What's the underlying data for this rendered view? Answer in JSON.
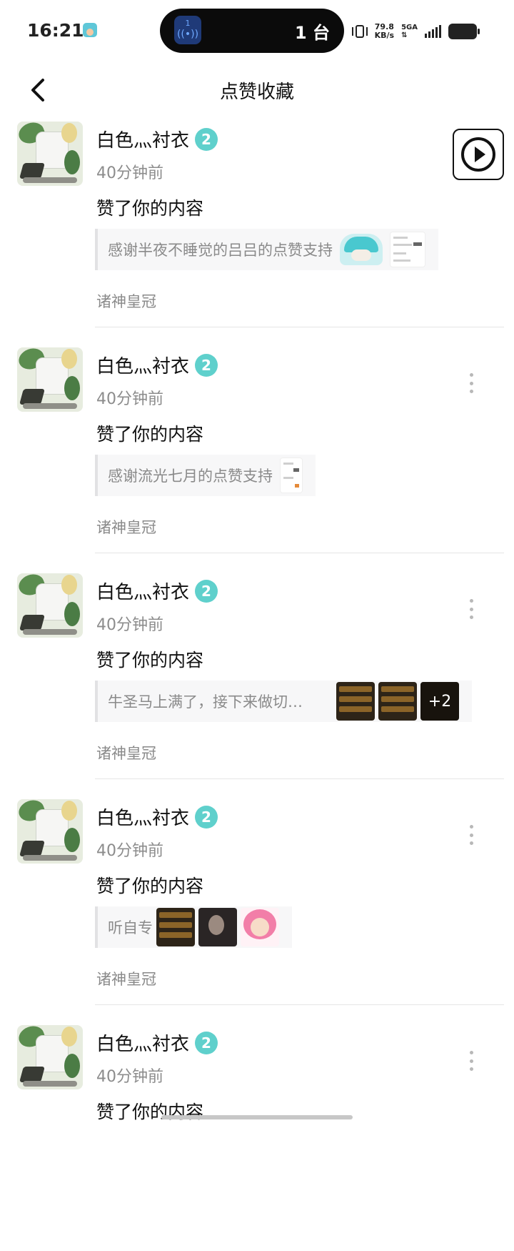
{
  "status_bar": {
    "time": "16:21",
    "island_badge": "1",
    "island_count": "1 台",
    "speed_value": "79.8",
    "speed_unit": "KB/s",
    "network": "5GA"
  },
  "header": {
    "title": "点赞收藏",
    "back_icon": "chevron-left-icon"
  },
  "floating_button": {
    "icon": "play-circle-icon"
  },
  "feed": {
    "items": [
      {
        "user_name": "白色灬衬衣",
        "level": "2",
        "time": "40分钟前",
        "action": "赞了你的内容",
        "quote": "感谢半夜不睡觉的吕吕的点赞支持",
        "group": "诸神皇冠"
      },
      {
        "user_name": "白色灬衬衣",
        "level": "2",
        "time": "40分钟前",
        "action": "赞了你的内容",
        "quote": "感谢流光七月的点赞支持",
        "group": "诸神皇冠"
      },
      {
        "user_name": "白色灬衬衣",
        "level": "2",
        "time": "40分钟前",
        "action": "赞了你的内容",
        "quote": "牛圣马上满了，接下来做切…",
        "extra_images": "+2",
        "group": "诸神皇冠"
      },
      {
        "user_name": "白色灬衬衣",
        "level": "2",
        "time": "40分钟前",
        "action": "赞了你的内容",
        "quote": "听自专",
        "group": "诸神皇冠"
      },
      {
        "user_name": "白色灬衬衣",
        "level": "2",
        "time": "40分钟前",
        "action": "赞了你的内容"
      }
    ]
  },
  "colors": {
    "level_badge": "#5fd0cc",
    "secondary_text": "#8a8a8a",
    "divider": "#e5e5e5"
  }
}
